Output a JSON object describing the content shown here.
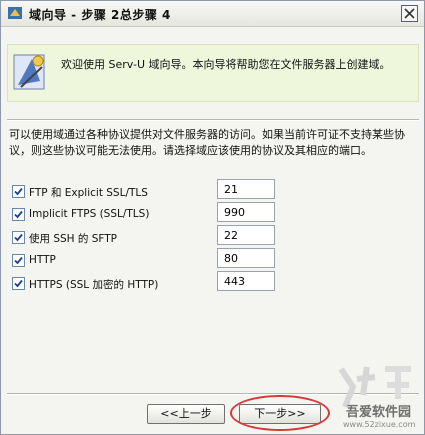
{
  "window": {
    "title": "域向导 - 步骤 2总步骤 4"
  },
  "header": {
    "text": "欢迎使用 Serv-U 域向导。本向导将帮助您在文件服务器上创建域。"
  },
  "description": "可以使用域通过各种协议提供对文件服务器的访问。如果当前许可证不支持某些协议，则这些协议可能无法使用。请选择域应该使用的协议及其相应的端口。",
  "protocols": [
    {
      "label": "FTP 和 Explicit SSL/TLS",
      "port": "21",
      "checked": true
    },
    {
      "label": "Implicit FTPS (SSL/TLS)",
      "port": "990",
      "checked": true
    },
    {
      "label": "使用 SSH 的 SFTP",
      "port": "22",
      "checked": true
    },
    {
      "label": "HTTP",
      "port": "80",
      "checked": true
    },
    {
      "label": "HTTPS (SSL 加密的 HTTP)",
      "port": "443",
      "checked": true
    }
  ],
  "buttons": {
    "back_label": "<<上一步",
    "next_label": "下一步>>"
  },
  "watermark": {
    "text": "吾爱软件园",
    "url": "www.52zixue.com"
  },
  "colors": {
    "header_bg": "#eef7dc",
    "highlight": "#d43a3a"
  },
  "icons": [
    "wizard-icon",
    "close-icon",
    "checkbox-check-icon"
  ]
}
